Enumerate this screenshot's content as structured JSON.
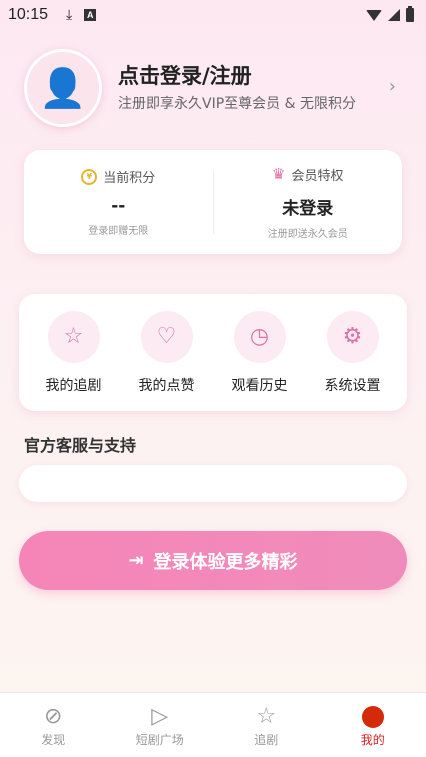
{
  "status_bar": {
    "time": "10:15",
    "download_icon": "⤓",
    "a_badge": "A"
  },
  "profile": {
    "avatar_icon": "👤",
    "title": "点击登录/注册",
    "subtitle": "注册即享永久VIP至尊会员 & 无限积分",
    "chevron": "›"
  },
  "stats": {
    "points": {
      "icon": "coin-icon",
      "label": "当前积分",
      "value": "--",
      "note": "登录即赠无限"
    },
    "membership": {
      "icon": "crown-icon",
      "label": "会员特权",
      "value": "未登录",
      "note": "注册即送永久会员"
    }
  },
  "quick_actions": [
    {
      "icon": "☆",
      "label": "我的追剧"
    },
    {
      "icon": "♡",
      "label": "我的点赞"
    },
    {
      "icon": "◷",
      "label": "观看历史"
    },
    {
      "icon": "⚙",
      "label": "系统设置"
    }
  ],
  "support": {
    "title": "官方客服与支持"
  },
  "login_button": {
    "icon": "⇥",
    "label": "登录体验更多精彩"
  },
  "bottom_nav": [
    {
      "icon": "⊘",
      "label": "发现"
    },
    {
      "icon": "▷",
      "label": "短剧广场"
    },
    {
      "icon": "☆",
      "label": "追剧"
    },
    {
      "icon": "●",
      "label": "我的"
    }
  ],
  "colors": {
    "accent": "#f585b8",
    "active_nav": "#e02020"
  }
}
